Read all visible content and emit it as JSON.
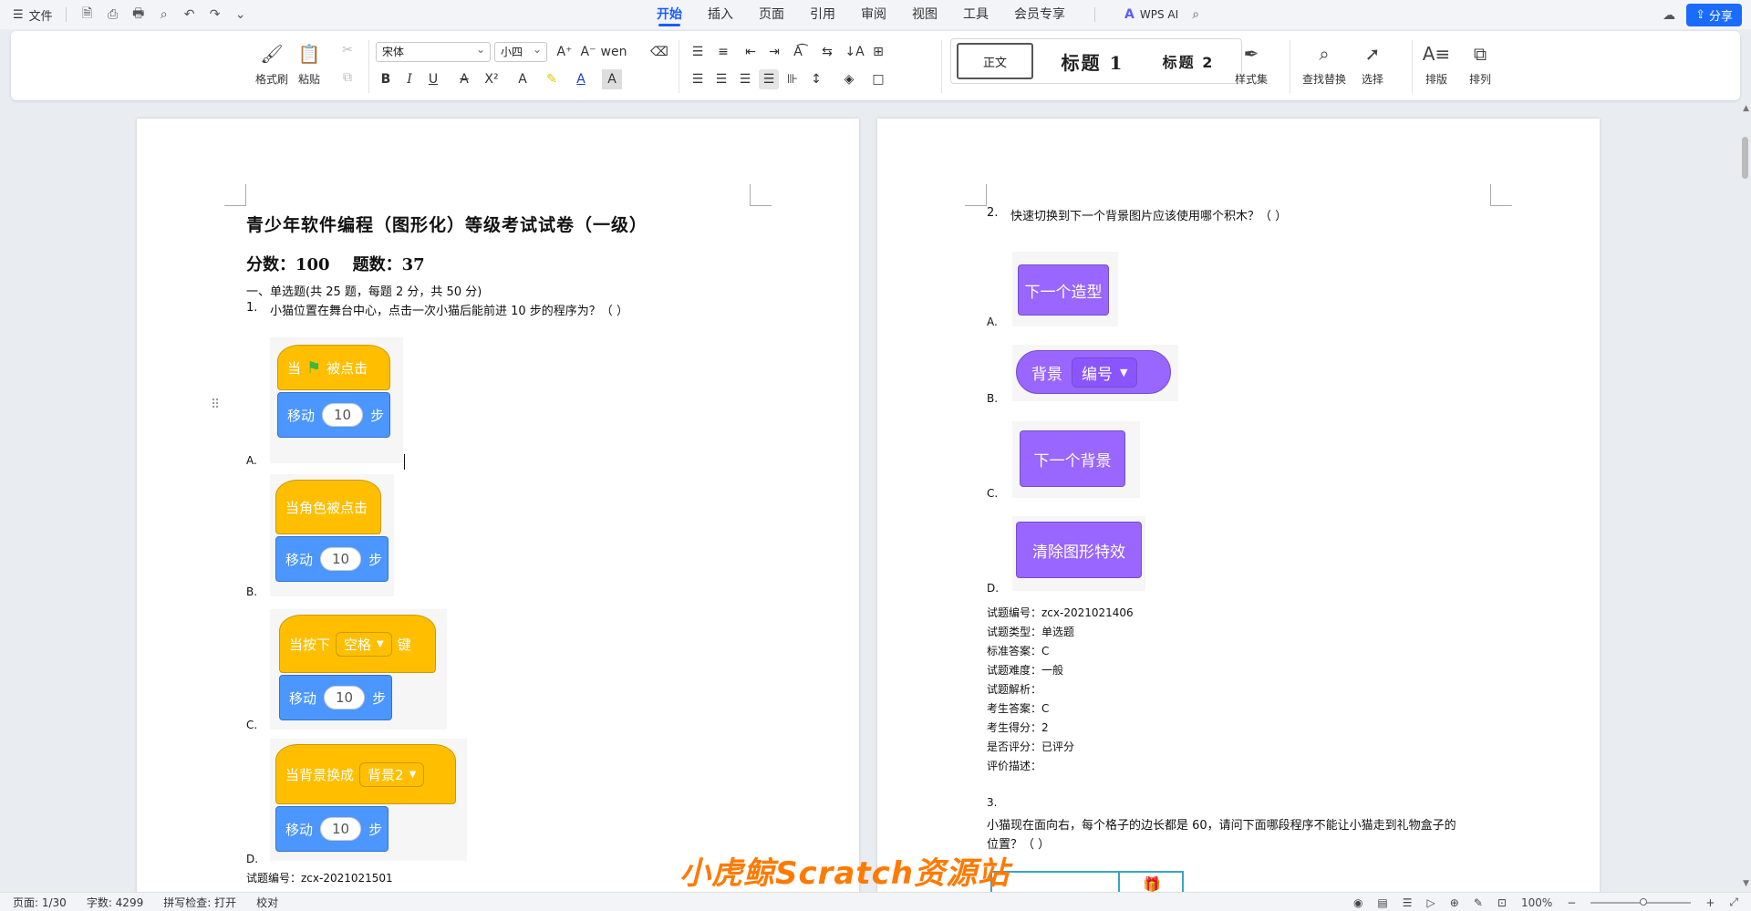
{
  "topbar": {
    "file_label": "文件",
    "tabs": [
      "开始",
      "插入",
      "页面",
      "引用",
      "审阅",
      "视图",
      "工具",
      "会员专享"
    ],
    "active_tab": "开始",
    "ai_label": "WPS AI",
    "share_label": "分享"
  },
  "ribbon": {
    "format_painter": "格式刷",
    "paste": "粘贴",
    "font_name": "宋体",
    "font_size": "小四",
    "style_normal": "正文",
    "style_h1": "标题 1",
    "style_h2": "标题 2",
    "style_set": "样式集",
    "find_replace": "查找替换",
    "select": "选择",
    "layout": "排版",
    "arrange": "排列"
  },
  "page1": {
    "title": "青少年软件编程（图形化）等级考试试卷（一级）",
    "score_line": "分数：100    题数：37",
    "section": "一、单选题(共 25 题，每题 2 分，共 50 分)",
    "q1_num": "1.",
    "q1_text": "小猫位置在舞台中心，点击一次小猫后能前进 10 步的程序为？（  ）",
    "options": [
      "A.",
      "B.",
      "C.",
      "D."
    ],
    "blockA_hat_when": "当",
    "blockA_hat_clicked": "被点击",
    "blockB_hat": "当角色被点击",
    "blockC_hat_when": "当按下",
    "blockC_key": "空格",
    "blockC_key_suffix": "键",
    "blockD_hat": "当背景换成",
    "blockD_bg": "背景2",
    "move_label": "移动",
    "move_steps": "10",
    "move_unit": "步",
    "footer_id": "试题编号：zcx-2021021501"
  },
  "page2": {
    "q2_num": "2.",
    "q2_text": "快速切换到下一个背景图片应该使用哪个积木？（  ）",
    "options": [
      "A.",
      "B.",
      "C.",
      "D."
    ],
    "blockA": "下一个造型",
    "blockB_label": "背景",
    "blockB_drop": "编号",
    "blockC": "下一个背景",
    "blockD": "清除图形特效",
    "info": [
      "试题编号：zcx-2021021406",
      "试题类型：单选题",
      "标准答案：C",
      "试题难度：一般",
      "试题解析：",
      "考生答案：C",
      "考生得分：2",
      "是否评分：已评分",
      "评价描述："
    ],
    "q3_num": "3.",
    "q3_text_line1": "小猫现在面向右，每个格子的边长都是 60，请问下面哪段程序不能让小猫走到礼物盒子的",
    "q3_text_line2": "位置？（  ）"
  },
  "watermark": "小虎鲸Scratch资源站",
  "statusbar": {
    "page": "页面: 1/30",
    "words": "字数: 4299",
    "spell": "拼写检查: 打开",
    "proof": "校对",
    "zoom": "100%"
  },
  "colors": {
    "accent": "#1a5cff",
    "events_yellow": "#ffbf00",
    "motion_blue": "#4c97ff",
    "looks_purple": "#9966ff"
  }
}
